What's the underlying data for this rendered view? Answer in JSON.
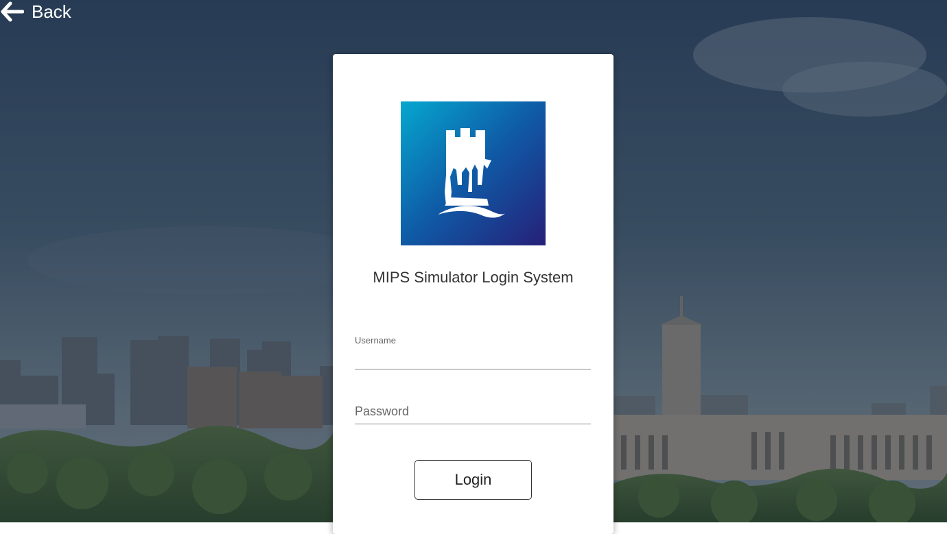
{
  "nav": {
    "back_label": "Back",
    "back_icon": "arrow-left-icon"
  },
  "login": {
    "logo_icon": "castle-tower-logo",
    "title": "MIPS Simulator Login System",
    "username_label": "Username",
    "username_value": "",
    "password_placeholder": "Password",
    "password_value": "",
    "login_label": "Login"
  },
  "colors": {
    "logo_gradient_start": "#06a7cf",
    "logo_gradient_mid": "#0f5aa6",
    "logo_gradient_end": "#262078",
    "overlay": "#1e2a3a"
  }
}
